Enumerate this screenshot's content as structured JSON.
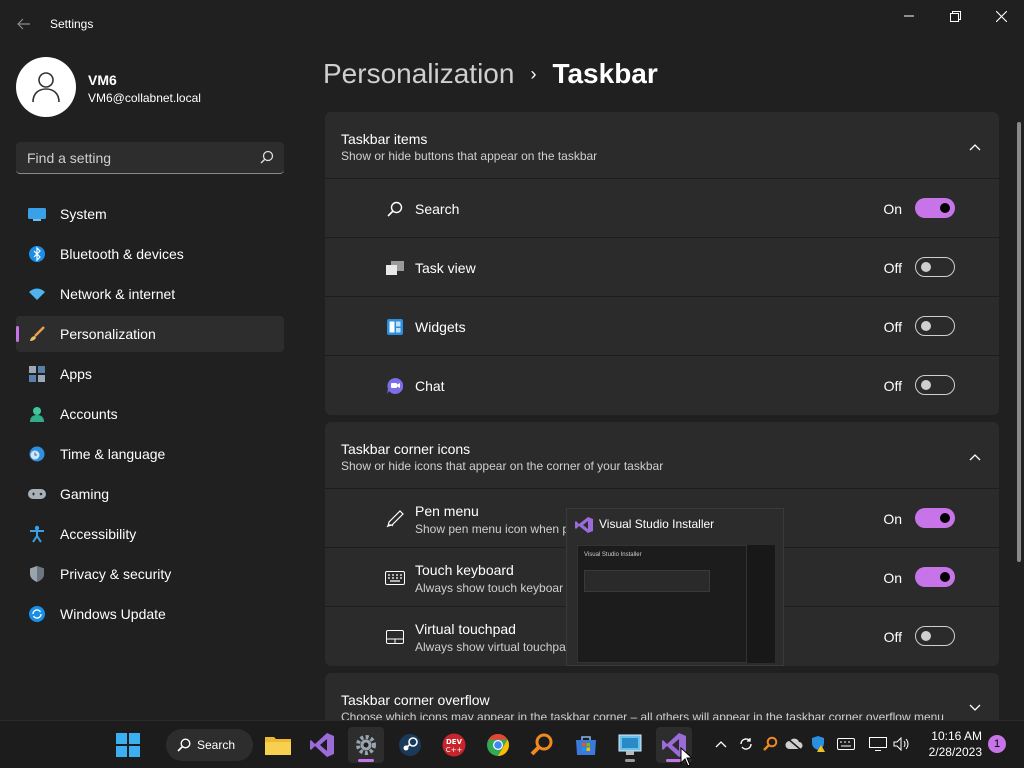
{
  "window": {
    "title": "Settings"
  },
  "profile": {
    "name": "VM6",
    "email": "VM6@collabnet.local"
  },
  "search": {
    "placeholder": "Find a setting"
  },
  "nav": {
    "items": [
      {
        "label": "System",
        "icon": "monitor-icon"
      },
      {
        "label": "Bluetooth & devices",
        "icon": "bluetooth-icon"
      },
      {
        "label": "Network & internet",
        "icon": "wifi-icon"
      },
      {
        "label": "Personalization",
        "icon": "brush-icon",
        "active": true
      },
      {
        "label": "Apps",
        "icon": "apps-icon"
      },
      {
        "label": "Accounts",
        "icon": "person-icon"
      },
      {
        "label": "Time & language",
        "icon": "clock-globe-icon"
      },
      {
        "label": "Gaming",
        "icon": "gamepad-icon"
      },
      {
        "label": "Accessibility",
        "icon": "accessibility-icon"
      },
      {
        "label": "Privacy & security",
        "icon": "shield-icon"
      },
      {
        "label": "Windows Update",
        "icon": "update-icon"
      }
    ]
  },
  "breadcrumb": {
    "parent": "Personalization",
    "separator": "›",
    "current": "Taskbar"
  },
  "sections": {
    "items": {
      "title": "Taskbar items",
      "subtitle": "Show or hide buttons that appear on the taskbar",
      "rows": [
        {
          "label": "Search",
          "state": "On"
        },
        {
          "label": "Task view",
          "state": "Off"
        },
        {
          "label": "Widgets",
          "state": "Off"
        },
        {
          "label": "Chat",
          "state": "Off"
        }
      ]
    },
    "corner": {
      "title": "Taskbar corner icons",
      "subtitle": "Show or hide icons that appear on the corner of your taskbar",
      "rows": [
        {
          "label": "Pen menu",
          "sub": "Show pen menu icon when p",
          "state": "On"
        },
        {
          "label": "Touch keyboard",
          "sub": "Always show touch keyboar",
          "state": "On"
        },
        {
          "label": "Virtual touchpad",
          "sub": "Always show virtual touchpa",
          "state": "Off"
        }
      ]
    },
    "overflow": {
      "title": "Taskbar corner overflow",
      "subtitle": "Choose which icons may appear in the taskbar corner – all others will appear in the taskbar corner overflow menu"
    }
  },
  "preview": {
    "title": "Visual Studio Installer",
    "thumb_title": "Visual Studio Installer"
  },
  "taskbar": {
    "search_label": "Search",
    "clock_time": "10:16 AM",
    "clock_date": "2/28/2023",
    "notification_count": "1"
  },
  "colors": {
    "accent": "#c774e8",
    "background": "#202020",
    "card": "#2b2b2b"
  }
}
